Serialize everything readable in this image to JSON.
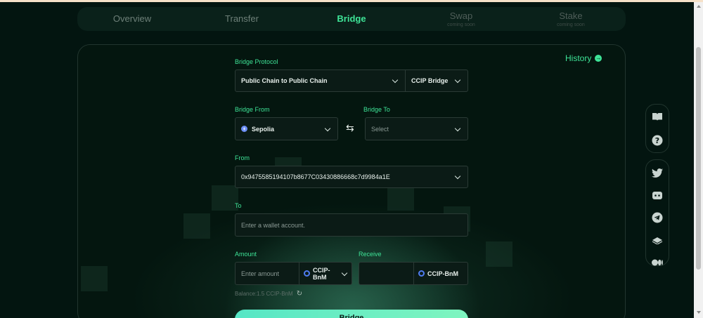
{
  "nav": {
    "tabs": [
      {
        "label": "Overview",
        "sub": ""
      },
      {
        "label": "Transfer",
        "sub": ""
      },
      {
        "label": "Bridge",
        "sub": ""
      },
      {
        "label": "Swap",
        "sub": "coming soon"
      },
      {
        "label": "Stake",
        "sub": "coming soon"
      }
    ],
    "active": "Bridge"
  },
  "history": {
    "label": "History"
  },
  "form": {
    "protocol_label": "Bridge Protocol",
    "protocol_value": "Public Chain to Public Chain",
    "protocol_type": "CCIP Bridge",
    "from_label": "Bridge From",
    "from_chain": "Sepolia",
    "to_label": "Bridge To",
    "to_placeholder": "Select",
    "from_addr_label": "From",
    "from_address": "0x9475585194107b8677C03430886668c7d9984a1E",
    "to_addr_label": "To",
    "to_placeholder_wallet": "Enter a wallet account.",
    "amount_label": "Amount",
    "amount_placeholder": "Enter amount",
    "amount_token": "CCIP-BnM",
    "receive_label": "Receive",
    "receive_token": "CCIP-BnM",
    "balance": "Balance:1.5 CCIP-BnM",
    "submit": "Bridge"
  },
  "icons": {
    "rail_top": [
      "book-icon",
      "help-icon"
    ],
    "rail_bottom": [
      "twitter-icon",
      "discord-icon",
      "telegram-icon",
      "gitbook-icon",
      "medium-icon"
    ]
  },
  "colors": {
    "accent": "#3ee497",
    "background": "#031510"
  }
}
